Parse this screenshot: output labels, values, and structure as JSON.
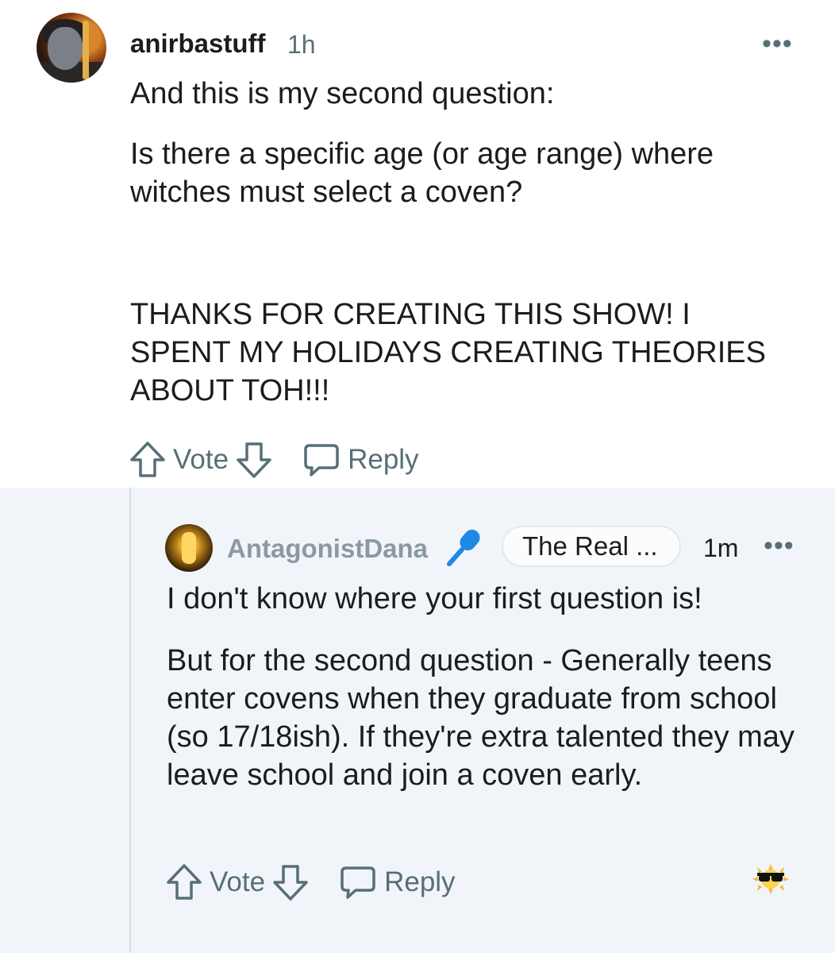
{
  "top_comment": {
    "username": "anirbastuff",
    "timestamp": "1h",
    "menu": "•••",
    "paragraphs": [
      "And this is my second question:",
      "Is there a specific age (or age range) where witches must select a coven?",
      "THANKS FOR CREATING THIS SHOW! I SPENT MY HOLIDAYS CREATING THEORIES ABOUT TOH!!!"
    ],
    "actions": {
      "vote_label": "Vote",
      "reply_label": "Reply"
    }
  },
  "reply_comment": {
    "username": "AntagonistDana",
    "flair": "The Real ...",
    "timestamp": "1m",
    "menu": "•••",
    "paragraphs": [
      "I don't know where your first question is!",
      "But for the second question - Generally teens enter covens when they graduate from school (so 17/18ish). If they're extra talented they may leave school and join a coven early."
    ],
    "actions": {
      "vote_label": "Vote",
      "reply_label": "Reply"
    },
    "award_icon": "sunglasses-sun-award-icon"
  },
  "colors": {
    "text": "#1c1c1c",
    "meta_text": "#576f76",
    "muted_username": "#8a9aa3",
    "mic_icon": "#1e88e5",
    "reply_background": "#f1f5f9",
    "thread_line": "#d7dde2"
  }
}
